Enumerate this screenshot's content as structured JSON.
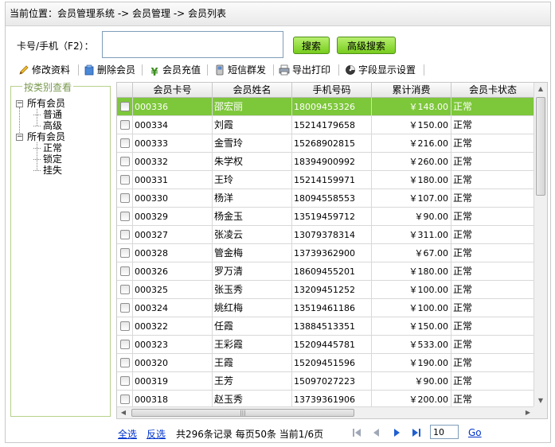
{
  "breadcrumb": "当前位置：会员管理系统 -> 会员管理 -> 会员列表",
  "search": {
    "label": "卡号/手机（F2）：",
    "value": "",
    "placeholder": "",
    "search_button": "搜索",
    "advanced_button": "高级搜索"
  },
  "toolbar": {
    "items": [
      {
        "label": "修改资料",
        "icon": "pencil-icon"
      },
      {
        "label": "删除会员",
        "icon": "delete-user-icon"
      },
      {
        "label": "会员充值",
        "icon": "yen-icon"
      },
      {
        "label": "短信群发",
        "icon": "phone-icon"
      },
      {
        "label": "导出打印",
        "icon": "printer-icon"
      },
      {
        "label": "字段显示设置",
        "icon": "settings-disc-icon"
      }
    ]
  },
  "category": {
    "title": "按类别查看",
    "tree": [
      {
        "label": "所有会员",
        "children": [
          "普通",
          "高级"
        ]
      },
      {
        "label": "所有会员",
        "children": [
          "正常",
          "锁定",
          "挂失"
        ]
      }
    ]
  },
  "grid": {
    "columns": [
      "会员卡号",
      "会员姓名",
      "手机号码",
      "累计消费",
      "会员卡状态"
    ],
    "selected_index": 0,
    "rows": [
      {
        "card": "000336",
        "name": "邵宏丽",
        "phone": "18009453326",
        "total": "￥148.00",
        "status": "正常"
      },
      {
        "card": "000334",
        "name": "刘霞",
        "phone": "15214179658",
        "total": "￥150.00",
        "status": "正常"
      },
      {
        "card": "000333",
        "name": "金雪玲",
        "phone": "15268902815",
        "total": "￥216.00",
        "status": "正常"
      },
      {
        "card": "000332",
        "name": "朱学权",
        "phone": "18394900992",
        "total": "￥260.00",
        "status": "正常"
      },
      {
        "card": "000331",
        "name": "王玲",
        "phone": "15214159971",
        "total": "￥180.00",
        "status": "正常"
      },
      {
        "card": "000330",
        "name": "杨洋",
        "phone": "18094558553",
        "total": "￥107.00",
        "status": "正常"
      },
      {
        "card": "000329",
        "name": "杨金玉",
        "phone": "13519459712",
        "total": "￥90.00",
        "status": "正常"
      },
      {
        "card": "000327",
        "name": "张凌云",
        "phone": "13079378314",
        "total": "￥311.00",
        "status": "正常"
      },
      {
        "card": "000328",
        "name": "管金梅",
        "phone": "13739362900",
        "total": "￥67.00",
        "status": "正常"
      },
      {
        "card": "000326",
        "name": "罗万清",
        "phone": "18609455201",
        "total": "￥180.00",
        "status": "正常"
      },
      {
        "card": "000325",
        "name": "张玉秀",
        "phone": "13209451252",
        "total": "￥100.00",
        "status": "正常"
      },
      {
        "card": "000324",
        "name": "姚红梅",
        "phone": "13519461186",
        "total": "￥100.00",
        "status": "正常"
      },
      {
        "card": "000322",
        "name": "任霞",
        "phone": "13884513351",
        "total": "￥150.00",
        "status": "正常"
      },
      {
        "card": "000323",
        "name": "王彩霞",
        "phone": "15209445781",
        "total": "￥533.00",
        "status": "正常"
      },
      {
        "card": "000320",
        "name": "王霞",
        "phone": "15209451596",
        "total": "￥190.00",
        "status": "正常"
      },
      {
        "card": "000319",
        "name": "王芳",
        "phone": "15097027223",
        "total": "￥90.00",
        "status": "正常"
      },
      {
        "card": "000318",
        "name": "赵玉秀",
        "phone": "13739361906",
        "total": "￥200.00",
        "status": "正常"
      }
    ]
  },
  "pager": {
    "select_all": "全选",
    "invert": "反选",
    "summary": "共296条记录  每页50条  当前1/6页",
    "page_input": "10",
    "go": "Go"
  },
  "colors": {
    "selected_row": "#7dc73a",
    "button_green": "#8fd63a",
    "link": "#0033cc"
  }
}
